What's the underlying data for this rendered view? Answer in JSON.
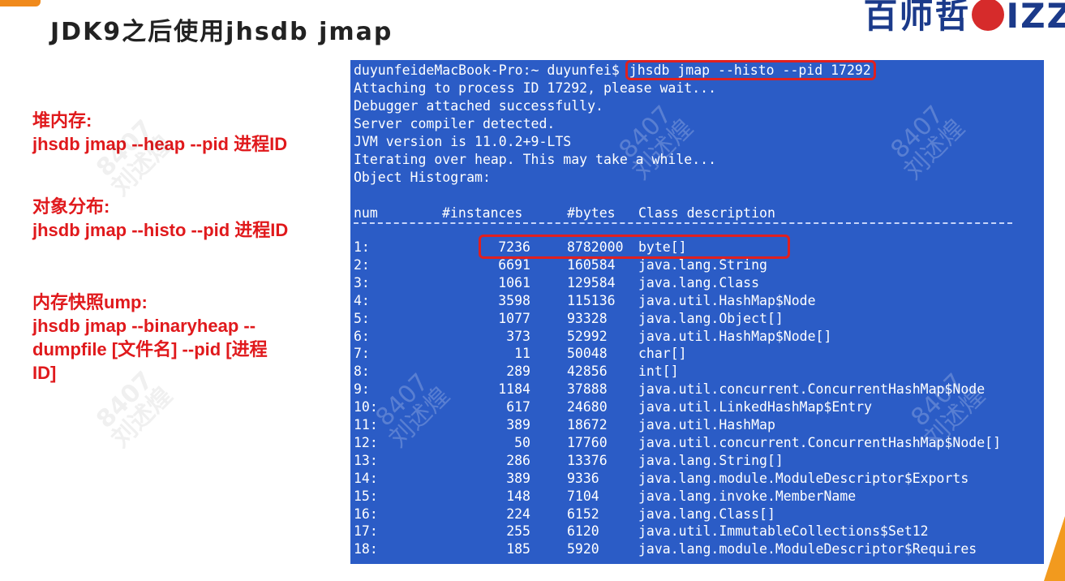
{
  "slide": {
    "title": "JDK9之后使用jhsdb jmap",
    "logo_text_left": "百师哲",
    "logo_text_right": "IZZ"
  },
  "notes": [
    {
      "heading": "堆内存:",
      "command": "jhsdb jmap --heap --pid 进程ID"
    },
    {
      "heading": "对象分布:",
      "command": "jhsdb jmap --histo --pid 进程ID"
    },
    {
      "heading": "内存快照ump:",
      "command_lines": [
        "jhsdb jmap --binaryheap --",
        "dumpfile [文件名] --pid [进程",
        "ID]"
      ]
    }
  ],
  "terminal": {
    "prompt": "duyunfeideMacBook-Pro:~ duyunfei$ ",
    "command": "jhsdb jmap --histo --pid 17292",
    "output_lines": [
      "Attaching to process ID 17292, please wait...",
      "Debugger attached successfully.",
      "Server compiler detected.",
      "JVM version is 11.0.2+9-LTS",
      "Iterating over heap. This may take a while...",
      "Object Histogram:"
    ],
    "columns": [
      "num",
      "#instances",
      "#bytes",
      "Class description"
    ],
    "rows": [
      {
        "num": "1:",
        "instances": "7236",
        "bytes": "8782000",
        "cls": "byte[]"
      },
      {
        "num": "2:",
        "instances": "6691",
        "bytes": "160584",
        "cls": "java.lang.String"
      },
      {
        "num": "3:",
        "instances": "1061",
        "bytes": "129584",
        "cls": "java.lang.Class"
      },
      {
        "num": "4:",
        "instances": "3598",
        "bytes": "115136",
        "cls": "java.util.HashMap$Node"
      },
      {
        "num": "5:",
        "instances": "1077",
        "bytes": "93328",
        "cls": "java.lang.Object[]"
      },
      {
        "num": "6:",
        "instances": "373",
        "bytes": "52992",
        "cls": "java.util.HashMap$Node[]"
      },
      {
        "num": "7:",
        "instances": "11",
        "bytes": "50048",
        "cls": "char[]"
      },
      {
        "num": "8:",
        "instances": "289",
        "bytes": "42856",
        "cls": "int[]"
      },
      {
        "num": "9:",
        "instances": "1184",
        "bytes": "37888",
        "cls": "java.util.concurrent.ConcurrentHashMap$Node"
      },
      {
        "num": "10:",
        "instances": "617",
        "bytes": "24680",
        "cls": "java.util.LinkedHashMap$Entry"
      },
      {
        "num": "11:",
        "instances": "389",
        "bytes": "18672",
        "cls": "java.util.HashMap"
      },
      {
        "num": "12:",
        "instances": "50",
        "bytes": "17760",
        "cls": "java.util.concurrent.ConcurrentHashMap$Node[]"
      },
      {
        "num": "13:",
        "instances": "286",
        "bytes": "13376",
        "cls": "java.lang.String[]"
      },
      {
        "num": "14:",
        "instances": "389",
        "bytes": "9336",
        "cls": "java.lang.module.ModuleDescriptor$Exports"
      },
      {
        "num": "15:",
        "instances": "148",
        "bytes": "7104",
        "cls": "java.lang.invoke.MemberName"
      },
      {
        "num": "16:",
        "instances": "224",
        "bytes": "6152",
        "cls": "java.lang.Class[]"
      },
      {
        "num": "17:",
        "instances": "255",
        "bytes": "6120",
        "cls": "java.util.ImmutableCollections$Set12"
      },
      {
        "num": "18:",
        "instances": "185",
        "bytes": "5920",
        "cls": "java.lang.module.ModuleDescriptor$Requires"
      }
    ]
  },
  "watermark": {
    "id": "8407",
    "name": "刘述煌"
  },
  "colors": {
    "terminal_bg": "#2b5cc6",
    "highlight": "#e0201f",
    "note_text": "#e0191c"
  }
}
